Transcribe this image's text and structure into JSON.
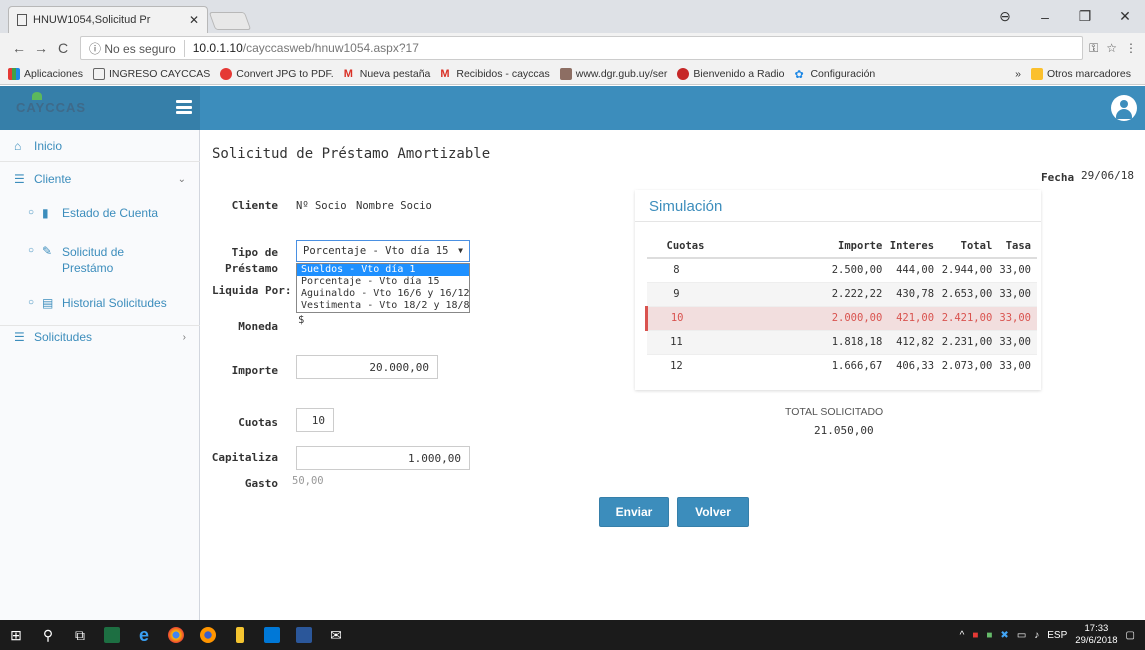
{
  "browser": {
    "tab_title": "HNUW1054,Solicitud Pr",
    "security": "No es seguro",
    "host": "10.0.1.10",
    "path": "/cayccasweb/hnuw1054.aspx?17",
    "bookmarks": [
      "Aplicaciones",
      "INGRESO CAYCCAS",
      "Convert JPG to PDF.",
      "Nueva pestaña",
      "Recibidos - cayccas",
      "www.dgr.gub.uy/ser",
      "Bienvenido a Radio",
      "Configuración"
    ],
    "bookmarks_more": "»",
    "other_bookmarks": "Otros marcadores"
  },
  "app": {
    "logo": "CAYCCAS"
  },
  "sidebar": {
    "inicio": "Inicio",
    "cliente": "Cliente",
    "estado_cuenta": "Estado de Cuenta",
    "solicitud_prestamo": "Solicitud de Prestámo",
    "historial": "Historial Solicitudes",
    "solicitudes": "Solicitudes"
  },
  "form": {
    "title": "Solicitud de Préstamo Amortizable",
    "fecha_label": "Fecha",
    "fecha_value": "29/06/18",
    "cliente_label": "Cliente",
    "nro_socio": "Nº Socio",
    "nombre_socio": "Nombre Socio",
    "tipo_label_1": "Tipo de",
    "tipo_label_2": "Préstamo",
    "tipo_selected": "Porcentaje - Vto día 15",
    "tipo_options": [
      "Sueldos - Vto día 1",
      "Porcentaje - Vto día 15",
      "Aguinaldo - Vto 16/6 y 16/12",
      "Vestimenta - Vto 18/2 y 18/8"
    ],
    "liquida_label": "Liquida Por:",
    "moneda_label": "Moneda",
    "moneda_value": "$",
    "importe_label": "Importe",
    "importe_value": "20.000,00",
    "cuotas_label": "Cuotas",
    "cuotas_value": "10",
    "capitaliza_label": "Capitaliza",
    "capitaliza_value": "1.000,00",
    "gasto_label": "Gasto",
    "gasto_value": "50,00"
  },
  "simulation": {
    "title": "Simulación",
    "headers": [
      "Cuotas",
      "Importe",
      "Interes",
      "Total",
      "Tasa"
    ],
    "rows": [
      [
        "8",
        "2.500,00",
        "444,00",
        "2.944,00",
        "33,00"
      ],
      [
        "9",
        "2.222,22",
        "430,78",
        "2.653,00",
        "33,00"
      ],
      [
        "10",
        "2.000,00",
        "421,00",
        "2.421,00",
        "33,00"
      ],
      [
        "11",
        "1.818,18",
        "412,82",
        "2.231,00",
        "33,00"
      ],
      [
        "12",
        "1.666,67",
        "406,33",
        "2.073,00",
        "33,00"
      ]
    ],
    "total_label": "TOTAL SOLICITADO",
    "total_value": "21.050,00"
  },
  "buttons": {
    "enviar": "Enviar",
    "volver": "Volver"
  },
  "taskbar": {
    "lang": "ESP",
    "time": "17:33",
    "date": "29/6/2018"
  },
  "colors": {
    "primary": "#3c8dbc",
    "highlight_row": "#f2dede",
    "highlight_text": "#d9534f"
  }
}
